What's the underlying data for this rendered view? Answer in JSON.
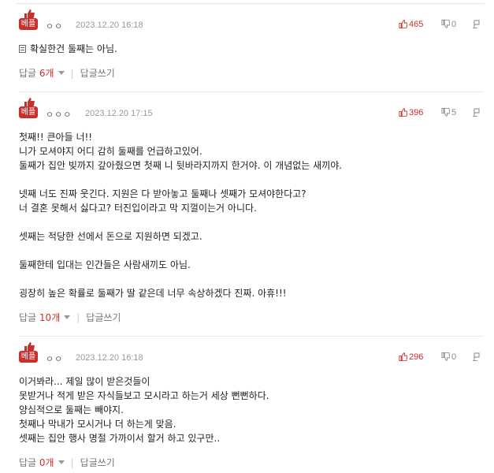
{
  "comments": [
    {
      "badge": "베플",
      "user": "ㅇㅇ",
      "date": "2023.12.20 16:18",
      "likes": "465",
      "dislikes": "0",
      "body": "확실한건 둘째는 아님.",
      "reply_label": "답글",
      "reply_count": "6개",
      "write_label": "답글쓰기"
    },
    {
      "badge": "베플",
      "user": "ㅇㅇㅇ",
      "date": "2023.12.20 17:15",
      "likes": "396",
      "dislikes": "5",
      "body": "첫째!! 큰아들 너!!\n니가 모셔야지 어디 감히 둘째를 언급하고있어.\n둘째가 집안 빚까지 갚아줬으면 첫째 니 뒷바라지까지 한거야. 이 개념없는 새끼야.\n\n넷째 너도 진짜 웃긴다. 지원은 다 받아놓고 둘째나 셋째가 모셔야한다고?\n너 결혼 못해서 싫다고? 터진입이라고 막 지껄이는거 아니다.\n\n셋째는 적당한 선에서 돈으로 지원하면 되겠고.\n\n둘째한테 입대는 인간들은 사람새끼도 아님.\n\n굉장히 높은 확률로 둘째가 딸 같은데 너무 속상하겠다 진짜. 아휴!!!",
      "reply_label": "답글",
      "reply_count": "10개",
      "write_label": "답글쓰기"
    },
    {
      "badge": "베플",
      "user": "ㅇㅇ",
      "date": "2023.12.20 16:18",
      "likes": "296",
      "dislikes": "0",
      "body": "이거봐라... 제일 많이 받은것들이\n못받거나 적게 받은 자식들보고 모시라고 하는거 세상 뻔뻔하다.\n양심적으로 둘째는 빼야지.\n첫째나 막내가 모시거나 더 하는게 맞음.\n셋째는 집안 행사 명절 가까이서 할거 하고 있구만..",
      "reply_label": "답글",
      "reply_count": "0개",
      "write_label": "답글쓰기"
    }
  ],
  "colors": {
    "accent": "#c9302c",
    "muted": "#999999"
  },
  "icons": {
    "like": "thumbs-up-icon",
    "dislike": "thumbs-down-icon",
    "report": "report-icon",
    "badge": "best-badge-icon",
    "doc": "document-icon"
  }
}
